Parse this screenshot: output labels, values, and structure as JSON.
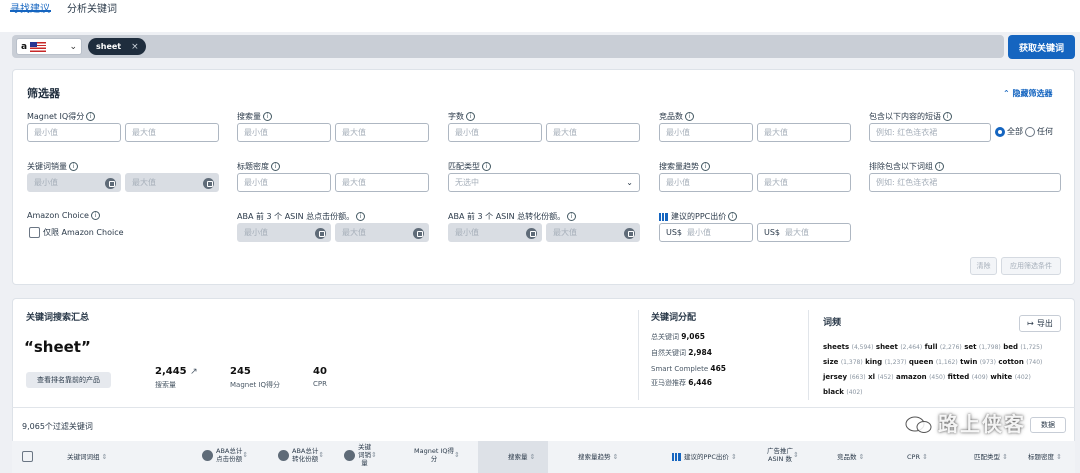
{
  "tabs": [
    {
      "label": "寻找建议"
    },
    {
      "label": "分析关键词"
    }
  ],
  "search": {
    "marketplace_logo": "a",
    "chip": "sheet",
    "chip_close": "×",
    "submit": "获取关键词"
  },
  "filters": {
    "title": "筛选器",
    "hide_link": "隐藏筛选器",
    "min": "最小值",
    "max": "最大值",
    "example": "例如: 红色连衣裙",
    "any_placeholder": "无选中",
    "usd": "US$",
    "labels": {
      "magnet_iq": "Magnet IQ得分",
      "search_volume": "搜索量",
      "word_count": "字数",
      "competing": "竞品数",
      "include": "包含以下内容的短语",
      "kw_sales": "关键词销量",
      "title_density": "标题密度",
      "match_type": "匹配类型",
      "sv_trend": "搜索量趋势",
      "exclude": "排除包含以下词组",
      "amazon_choice": "Amazon Choice",
      "aba_click": "ABA 前 3 个 ASIN 总点击份额。",
      "aba_conv": "ABA 前 3 个 ASIN 总转化份额。",
      "ppc": "建议的PPC出价"
    },
    "radio_all": "全部",
    "radio_any": "任何",
    "amazon_choice_only": "仅限 Amazon Choice",
    "clear": "清除",
    "apply": "应用筛选条件"
  },
  "summary": {
    "title": "关键词搜索汇总",
    "keyword": "“sheet”",
    "view_products": "查看排名靠前的产品",
    "stats": [
      {
        "value": "2,445",
        "label": "搜索量"
      },
      {
        "value": "245",
        "label": "Magnet IQ得分"
      },
      {
        "value": "40",
        "label": "CPR"
      }
    ],
    "filtered_count": "9,065个过滤关键词"
  },
  "distribution": {
    "title": "关键词分配",
    "rows": [
      {
        "label": "总关键词",
        "value": "9,065"
      },
      {
        "label": "自然关键词",
        "value": "2,984"
      },
      {
        "label": "Smart Complete",
        "value": "465"
      },
      {
        "label": "亚马逊推荐",
        "value": "6,446"
      }
    ]
  },
  "frequency": {
    "title": "词频",
    "export": "导出",
    "lines": [
      [
        {
          "w": "sheets",
          "c": "(4,594)"
        },
        {
          "w": "sheet",
          "c": "(2,464)"
        },
        {
          "w": "full",
          "c": "(2,276)"
        },
        {
          "w": "set",
          "c": "(1,798)"
        },
        {
          "w": "bed",
          "c": "(1,725)"
        }
      ],
      [
        {
          "w": "size",
          "c": "(1,378)"
        },
        {
          "w": "king",
          "c": "(1,237)"
        },
        {
          "w": "queen",
          "c": "(1,162)"
        },
        {
          "w": "twin",
          "c": "(973)"
        },
        {
          "w": "cotton",
          "c": "(740)"
        }
      ],
      [
        {
          "w": "jersey",
          "c": "(663)"
        },
        {
          "w": "xl",
          "c": "(452)"
        },
        {
          "w": "amazon",
          "c": "(450)"
        },
        {
          "w": "fitted",
          "c": "(409)"
        },
        {
          "w": "white",
          "c": "(402)"
        }
      ],
      [
        {
          "w": "black",
          "c": "(402)"
        }
      ]
    ]
  },
  "table_headers": {
    "phrase": "关键词词组",
    "aba_click": "ABA总计\n点击份额",
    "aba_conv": "ABA总计\n转化份额",
    "kw_sales": "关键\n词销\n量",
    "magnet_iq": "Magnet IQ得\n分",
    "search_volume": "搜索量",
    "sv_trend": "搜索量趋势",
    "ppc": "建议的PPC出价",
    "sponsored_asins": "广告推广\nASIN 数",
    "competing": "竞品数",
    "cpr": "CPR",
    "match_type": "匹配类型",
    "title_density": "标题密度"
  },
  "partial_button": "数据",
  "watermark": "路上侠客",
  "colors": {
    "accent": "#1565c0",
    "dark_chip": "#1f2d3d",
    "disabled": "#d9dde3"
  }
}
